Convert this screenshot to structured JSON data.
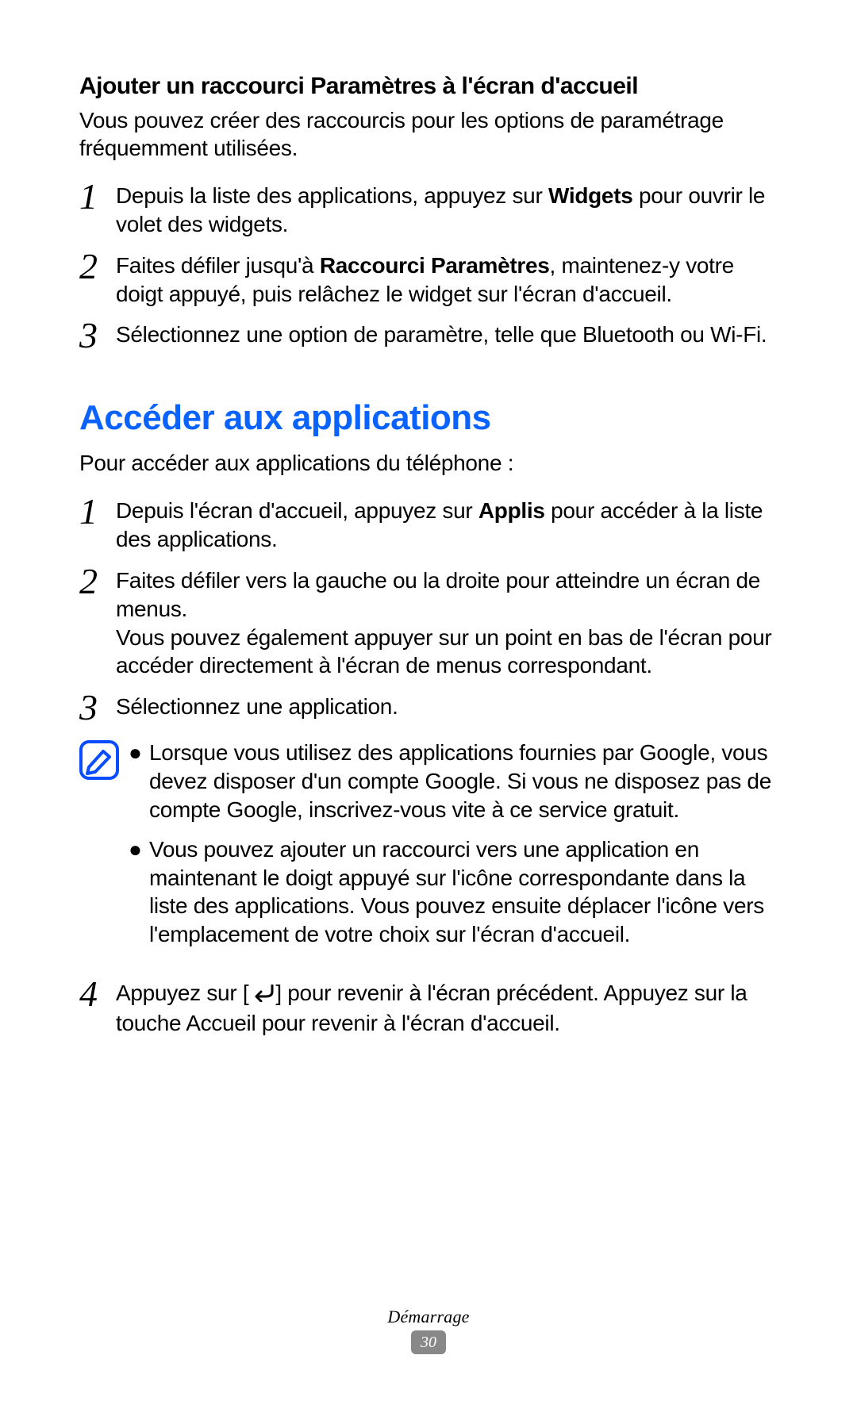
{
  "section1": {
    "title": "Ajouter un raccourci Paramètres à l'écran d'accueil",
    "intro": "Vous pouvez créer des raccourcis pour les options de paramétrage fréquemment utilisées.",
    "steps": {
      "s1": {
        "num": "1",
        "pre": "Depuis la liste des applications, appuyez sur ",
        "bold": "Widgets",
        "post": " pour ouvrir le volet des widgets."
      },
      "s2": {
        "num": "2",
        "pre": "Faites défiler jusqu'à ",
        "bold": "Raccourci Paramètres",
        "post": ", maintenez-y votre doigt appuyé, puis relâchez le widget sur l'écran d'accueil."
      },
      "s3": {
        "num": "3",
        "text": "Sélectionnez une option de paramètre, telle que Bluetooth ou Wi-Fi."
      }
    }
  },
  "section2": {
    "title": "Accéder aux applications",
    "intro": "Pour accéder aux applications du téléphone :",
    "steps": {
      "s1": {
        "num": "1",
        "pre": "Depuis l'écran d'accueil, appuyez sur ",
        "bold": "Applis",
        "post": " pour accéder à la liste des applications."
      },
      "s2": {
        "num": "2",
        "line1": "Faites défiler vers la gauche ou la droite pour atteindre un écran de menus.",
        "line2": "Vous pouvez également appuyer sur un point en bas de l'écran pour accéder directement à l'écran de menus correspondant."
      },
      "s3": {
        "num": "3",
        "text": "Sélectionnez une application."
      },
      "s4": {
        "num": "4",
        "pre": "Appuyez sur [",
        "post": "] pour revenir à l'écran précédent. Appuyez sur la touche Accueil pour revenir à l'écran d'accueil."
      }
    },
    "notes": {
      "b1": "Lorsque vous utilisez des applications fournies par Google, vous devez disposer d'un compte Google. Si vous ne disposez pas de compte Google, inscrivez-vous vite à ce service gratuit.",
      "b2": "Vous pouvez ajouter un raccourci vers une application en maintenant le doigt appuyé sur l'icône correspondante dans la liste des applications. Vous pouvez ensuite déplacer l'icône vers l'emplacement de votre choix sur l'écran d'accueil."
    }
  },
  "footer": {
    "label": "Démarrage",
    "page": "30"
  },
  "bullet": "●"
}
